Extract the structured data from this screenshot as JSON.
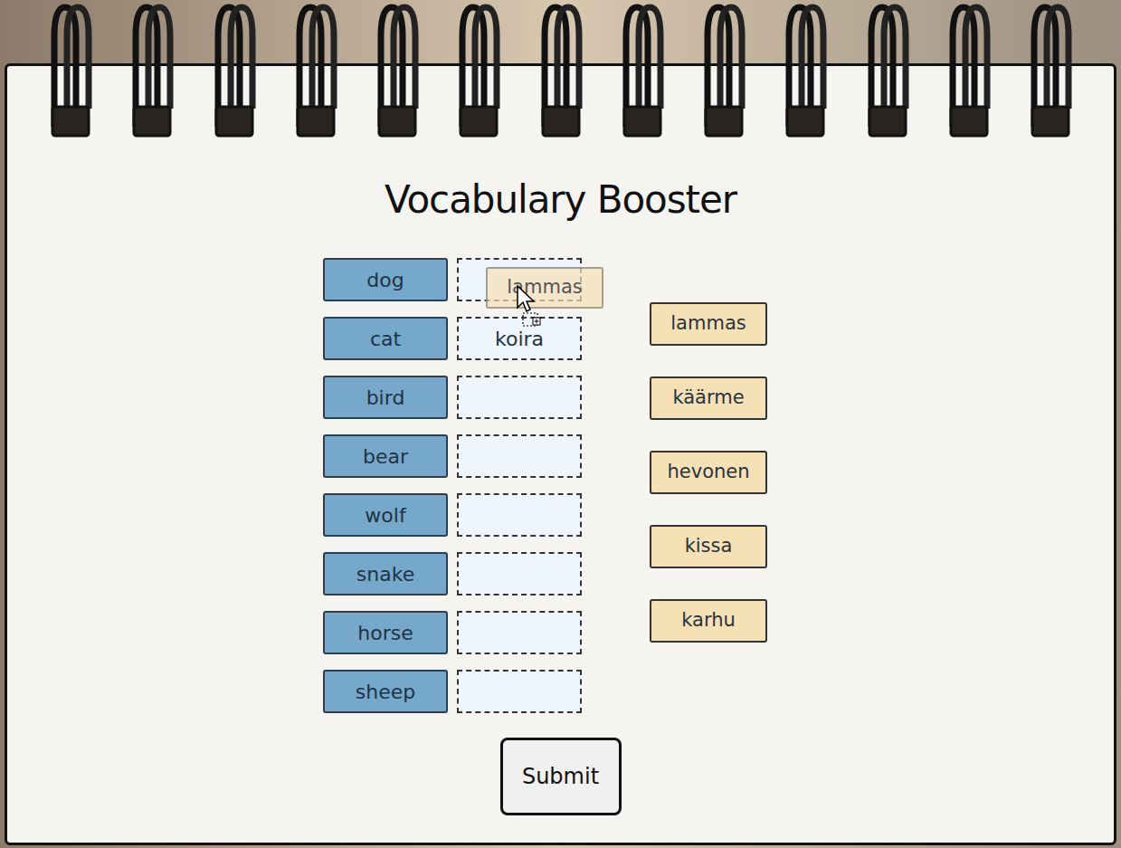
{
  "app": {
    "title": "Vocabulary Booster"
  },
  "pairs": [
    {
      "word": "dog",
      "answer": ""
    },
    {
      "word": "cat",
      "answer": "koira"
    },
    {
      "word": "bird",
      "answer": ""
    },
    {
      "word": "bear",
      "answer": ""
    },
    {
      "word": "wolf",
      "answer": ""
    },
    {
      "word": "snake",
      "answer": ""
    },
    {
      "word": "horse",
      "answer": ""
    },
    {
      "word": "sheep",
      "answer": ""
    }
  ],
  "options": [
    "lammas",
    "käärme",
    "hevonen",
    "kissa",
    "karhu"
  ],
  "drag_ghost": {
    "label": "lammas"
  },
  "buttons": [
    "Submit"
  ]
}
